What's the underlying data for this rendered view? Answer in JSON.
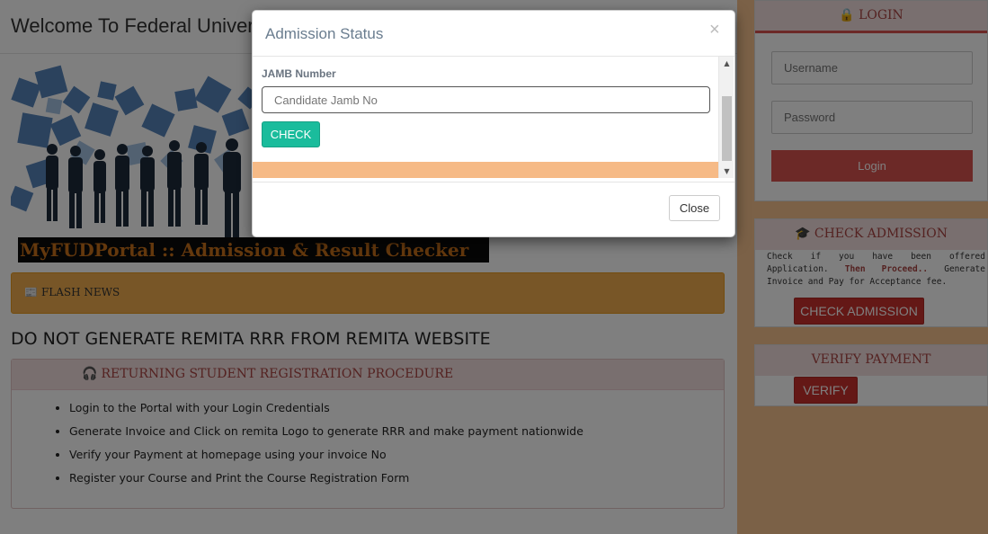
{
  "page": {
    "welcome_title": "Welcome To Federal Univer"
  },
  "banner": {
    "caption": "MyFUDPortal :: Admission & Result Checker"
  },
  "flash_news": {
    "icon": "newspaper-icon",
    "icon_glyph": "📰",
    "label": "FLASH NEWS"
  },
  "notice": {
    "text": "DO NOT GENERATE REMITA RRR FROM REMITA WEBSITE"
  },
  "procedure": {
    "icon": "headphones-icon",
    "icon_glyph": "🎧",
    "title": "RETURNING STUDENT REGISTRATION PROCEDURE",
    "steps": [
      "Login to the Portal with your Login Credentials",
      "Generate Invoice and Click on remita Logo to generate RRR and make payment nationwide",
      "Verify your Payment at homepage using your invoice No",
      "Register your Course and Print the Course Registration Form"
    ]
  },
  "login": {
    "icon": "lock-icon",
    "icon_glyph": "🔒",
    "title": "LOGIN",
    "username_placeholder": "Username",
    "password_placeholder": "Password",
    "button": "Login"
  },
  "check_admission": {
    "icon": "graduation-cap-icon",
    "icon_glyph": "🎓",
    "title": "CHECK ADMISSION",
    "note_part1": "Check if you have been offered Application.",
    "note_bold": "Then Proceed..",
    "note_part2": "Generate Invoice and Pay for Acceptance fee.",
    "button": "CHECK ADMISSION"
  },
  "verify_payment": {
    "title": "VERIFY PAYMENT",
    "button": "VERIFY"
  },
  "modal": {
    "title": "Admission Status",
    "close_x": "×",
    "jamb_label": "JAMB Number",
    "jamb_placeholder": "Candidate Jamb No",
    "check_button": "CHECK",
    "close_button": "Close"
  },
  "colors": {
    "accent_red": "#d9534f",
    "flash_orange": "#f0ad4e",
    "sidebar_bg": "#f6c38e",
    "check_green": "#1abc9c"
  }
}
